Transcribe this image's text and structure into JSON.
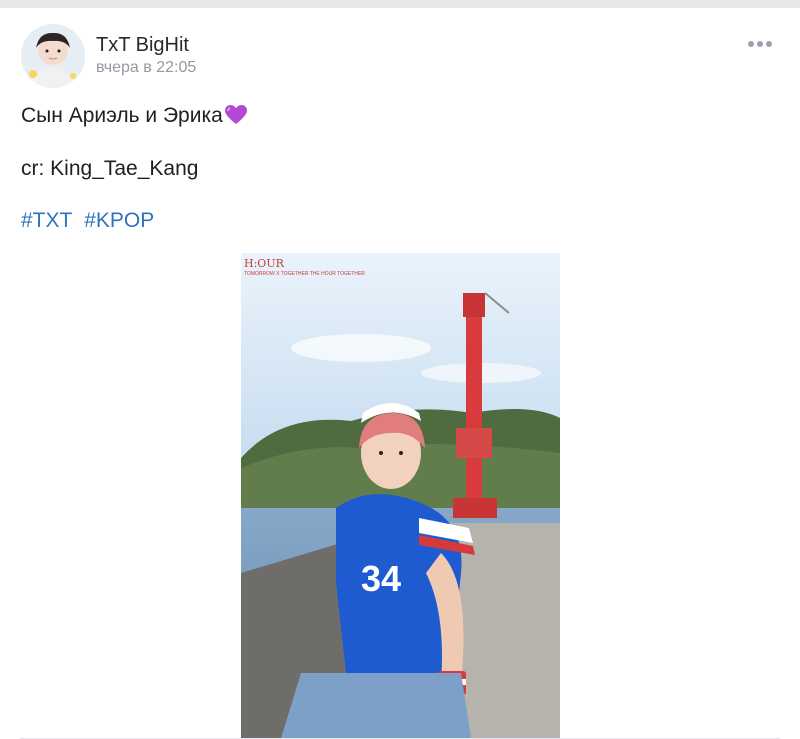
{
  "post": {
    "author": "TxT BigHit",
    "time": "вчера в 22:05",
    "text_line1": "Сын Ариэль и Эрика",
    "text_line2": "cr: King_Tae_Kang",
    "hashtags": [
      "#TXT",
      "#KPOP"
    ]
  },
  "photo": {
    "watermark_title": "H:OUR",
    "watermark_subtitle": "TOMORROW X TOGETHER\nTHE HOUR TOGETHER",
    "jersey_number": "34"
  },
  "colors": {
    "link": "#2f73c0",
    "muted": "#939aa3",
    "heart": "#b349d6"
  },
  "icons": {
    "more": "ellipsis-icon",
    "heart": "purple-heart-icon"
  }
}
